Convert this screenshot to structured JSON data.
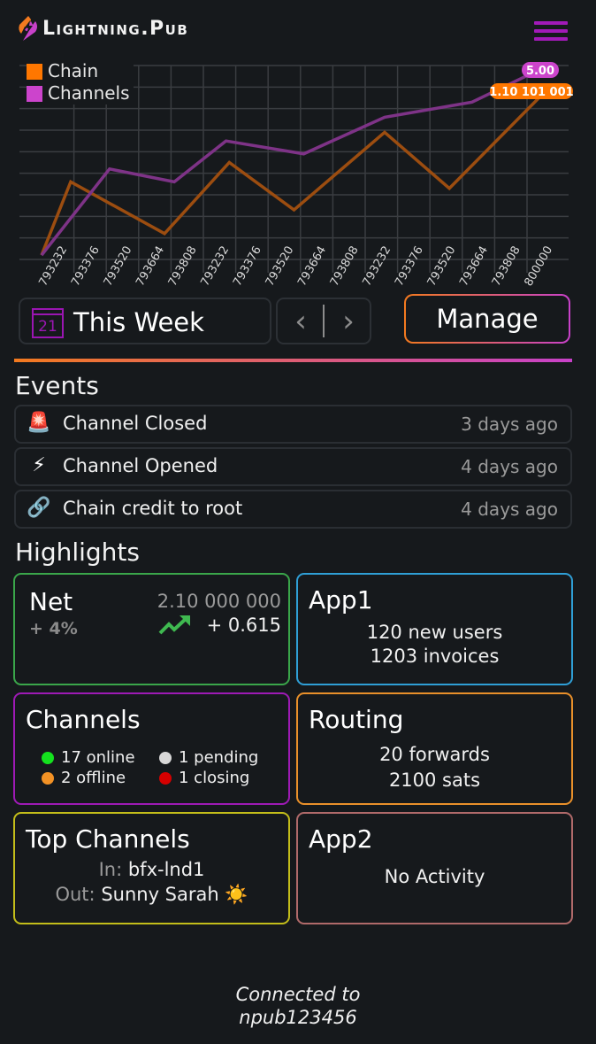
{
  "header": {
    "app_name": "Lightning.Pub",
    "menu_icon": "hamburger-menu-icon"
  },
  "chart_data": {
    "type": "line",
    "title": "",
    "xlabel": "",
    "ylabel": "",
    "x": [
      "793232",
      "793376",
      "793520",
      "793664",
      "793808",
      "793232",
      "793376",
      "793520",
      "793664",
      "793808",
      "793232",
      "793376",
      "793520",
      "793664",
      "793808",
      "800000"
    ],
    "grid": true,
    "legend_position": "top-left",
    "ylim": [
      0,
      9
    ],
    "series": [
      {
        "name": "Chain",
        "color": "#ff7700",
        "line_color": "#9c4d10",
        "points": [
          [
            0,
            0.2
          ],
          [
            0.9,
            3.6
          ],
          [
            3.8,
            1.2
          ],
          [
            5.8,
            4.5
          ],
          [
            7.8,
            2.3
          ],
          [
            10.6,
            5.9
          ],
          [
            12.6,
            3.3
          ],
          [
            15.5,
            7.7
          ]
        ],
        "end_label": "1.10 101 001"
      },
      {
        "name": "Channels",
        "color": "#cc44cc",
        "line_color": "#7e3387",
        "points": [
          [
            0,
            0.2
          ],
          [
            2.1,
            4.2
          ],
          [
            4.1,
            3.6
          ],
          [
            5.7,
            5.5
          ],
          [
            8.1,
            4.9
          ],
          [
            10.6,
            6.6
          ],
          [
            13.3,
            7.3
          ],
          [
            15.1,
            8.6
          ]
        ],
        "end_label": "5.00"
      }
    ]
  },
  "controls": {
    "calendar_day": "21",
    "period_label": "This Week",
    "prev_icon": "‹",
    "next_icon": "›",
    "manage_label": "Manage"
  },
  "events": {
    "title": "Events",
    "items": [
      {
        "icon": "🚨",
        "icon_name": "siren-icon",
        "label": "Channel Closed",
        "time": "3 days ago"
      },
      {
        "icon": "⚡",
        "icon_name": "lightning-icon",
        "label": "Channel Opened",
        "time": "4 days ago"
      },
      {
        "icon": "🔗",
        "icon_name": "link-icon",
        "label": "Chain credit to root",
        "time": "4 days ago"
      }
    ]
  },
  "highlights": {
    "title": "Highlights",
    "net": {
      "title": "Net",
      "percent": "+ 4%",
      "total": "2.10 000 000",
      "delta": "+ 0.615",
      "border": "#3aa64a"
    },
    "app1": {
      "title": "App1",
      "line1": "120 new users",
      "line2": "1203 invoices",
      "border": "#2f9fd6"
    },
    "channels": {
      "title": "Channels",
      "border": "#9e1ab5",
      "stats": [
        {
          "label": "17 online",
          "color": "#14e21e"
        },
        {
          "label": "1 pending",
          "color": "#d8d8d8"
        },
        {
          "label": "2 offline",
          "color": "#f39225"
        },
        {
          "label": "1 closing",
          "color": "#d60000"
        }
      ]
    },
    "routing": {
      "title": "Routing",
      "line1": "20 forwards",
      "line2": "2100 sats",
      "border": "#e9902a"
    },
    "top_channels": {
      "title": "Top Channels",
      "in_key": "In:",
      "in_value": "bfx-lnd1",
      "out_key": "Out:",
      "out_value": "Sunny Sarah ☀️",
      "border": "#c3bd1a"
    },
    "app2": {
      "title": "App2",
      "line1": "No Activity",
      "border": "#b06a6a"
    }
  },
  "footer": {
    "line1": "Connected to",
    "line2": "npub123456"
  }
}
